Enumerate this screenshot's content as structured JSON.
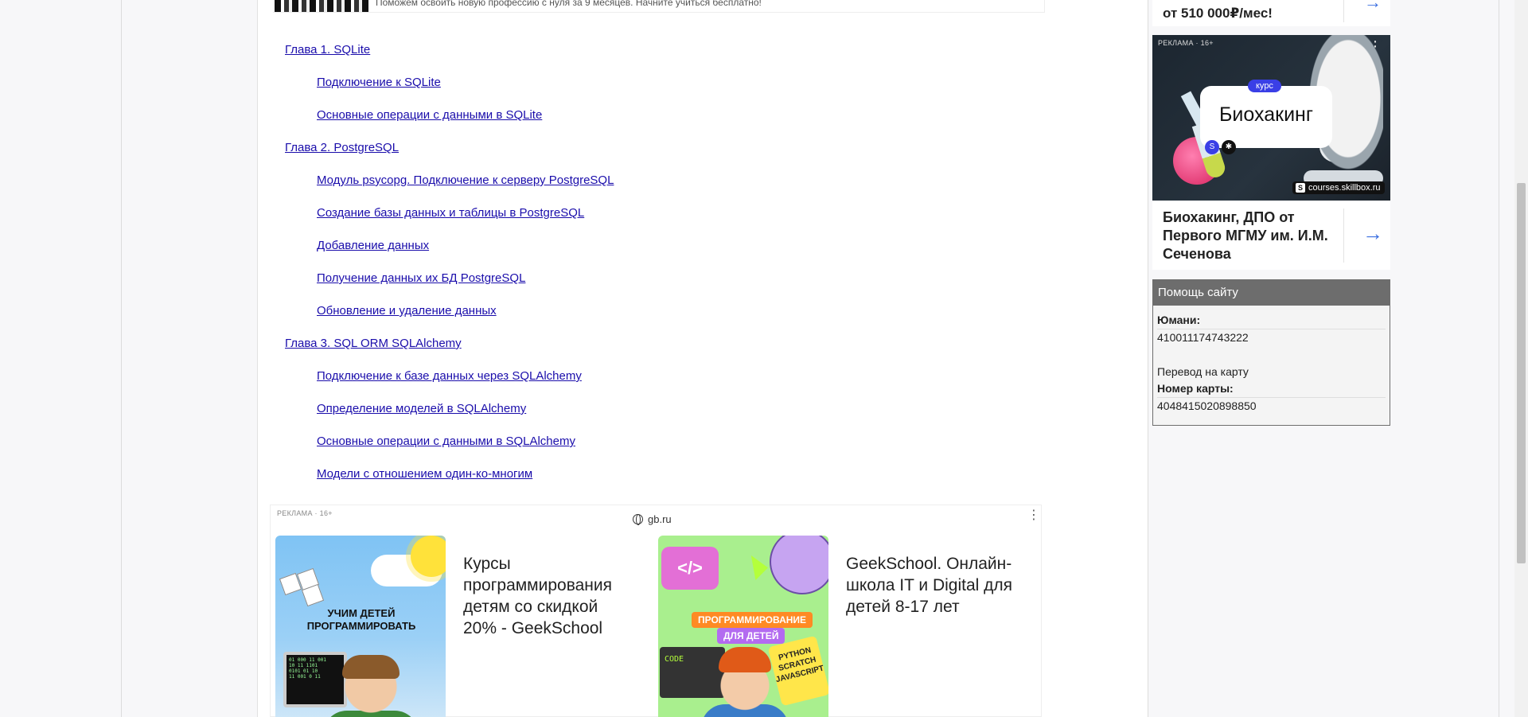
{
  "top_ad": {
    "text": "Поможем освоить новую профессию с нуля за 9 месяцев. Начните учиться бесплатно!"
  },
  "toc": {
    "chapters": [
      {
        "label": "Глава 1. SQLite",
        "items": [
          "Подключение к SQLite",
          "Основные операции с данными в SQLite"
        ]
      },
      {
        "label": "Глава 2. PostgreSQL",
        "items": [
          "Модуль psycopg. Подключение к серверу PostgreSQL",
          "Создание базы данных и таблицы в PostgreSQL",
          "Добавление данных",
          "Получение данных их БД PostgreSQL",
          "Обновление и удаление данных"
        ]
      },
      {
        "label": "Глава 3. SQL ORM SQLAlchemy",
        "items": [
          "Подключение к базе данных через SQLAlchemy",
          "Определение моделей в SQLAlchemy",
          "Основные операции с данными в SQLAlchemy",
          "Модели с отношением один-ко-многим"
        ]
      }
    ]
  },
  "bottom_ad": {
    "label": "РЕКЛАМА · 16+",
    "domain": "gb.ru",
    "cards": [
      {
        "title": "Курсы программирования детям со скидкой 20% - GeekSchool",
        "image_text": "УЧИМ ДЕТЕЙ ПРОГРАММИРОВАТЬ"
      },
      {
        "title": "GeekSchool. Онлайн-школа IT и Digital для детей 8-17 лет",
        "image_text": [
          "ПРОГРАММИРОВАНИЕ",
          "ДЛЯ ДЕТЕЙ"
        ],
        "sticker": "PYTHON SCRATCH JAVASCRIPT",
        "bubble": "</>",
        "laptop": "CODE"
      }
    ]
  },
  "sidebar": {
    "top_card": {
      "text": "от 510 000₽/мес!",
      "arrow": "→"
    },
    "ad": {
      "label": "РЕКЛАМА · 16+",
      "chip": "курс",
      "card_title": "Биохакинг",
      "domain": "courses.skillbox.ru",
      "title": "Биохакинг, ДПО от Первого МГМУ им. И.М. Сеченова",
      "arrow": "→"
    },
    "help": {
      "heading": "Помощь сайту",
      "yoomoney_label": "Юмани:",
      "yoomoney_value": "410011174743222",
      "transfer_text": "Перевод на карту",
      "card_label": "Номер карты:",
      "card_value": "4048415020898850"
    }
  },
  "colors": {
    "link": "#1a0dab",
    "help_header": "#6d6d6d",
    "arrow_accent": "#3b6fe0"
  }
}
